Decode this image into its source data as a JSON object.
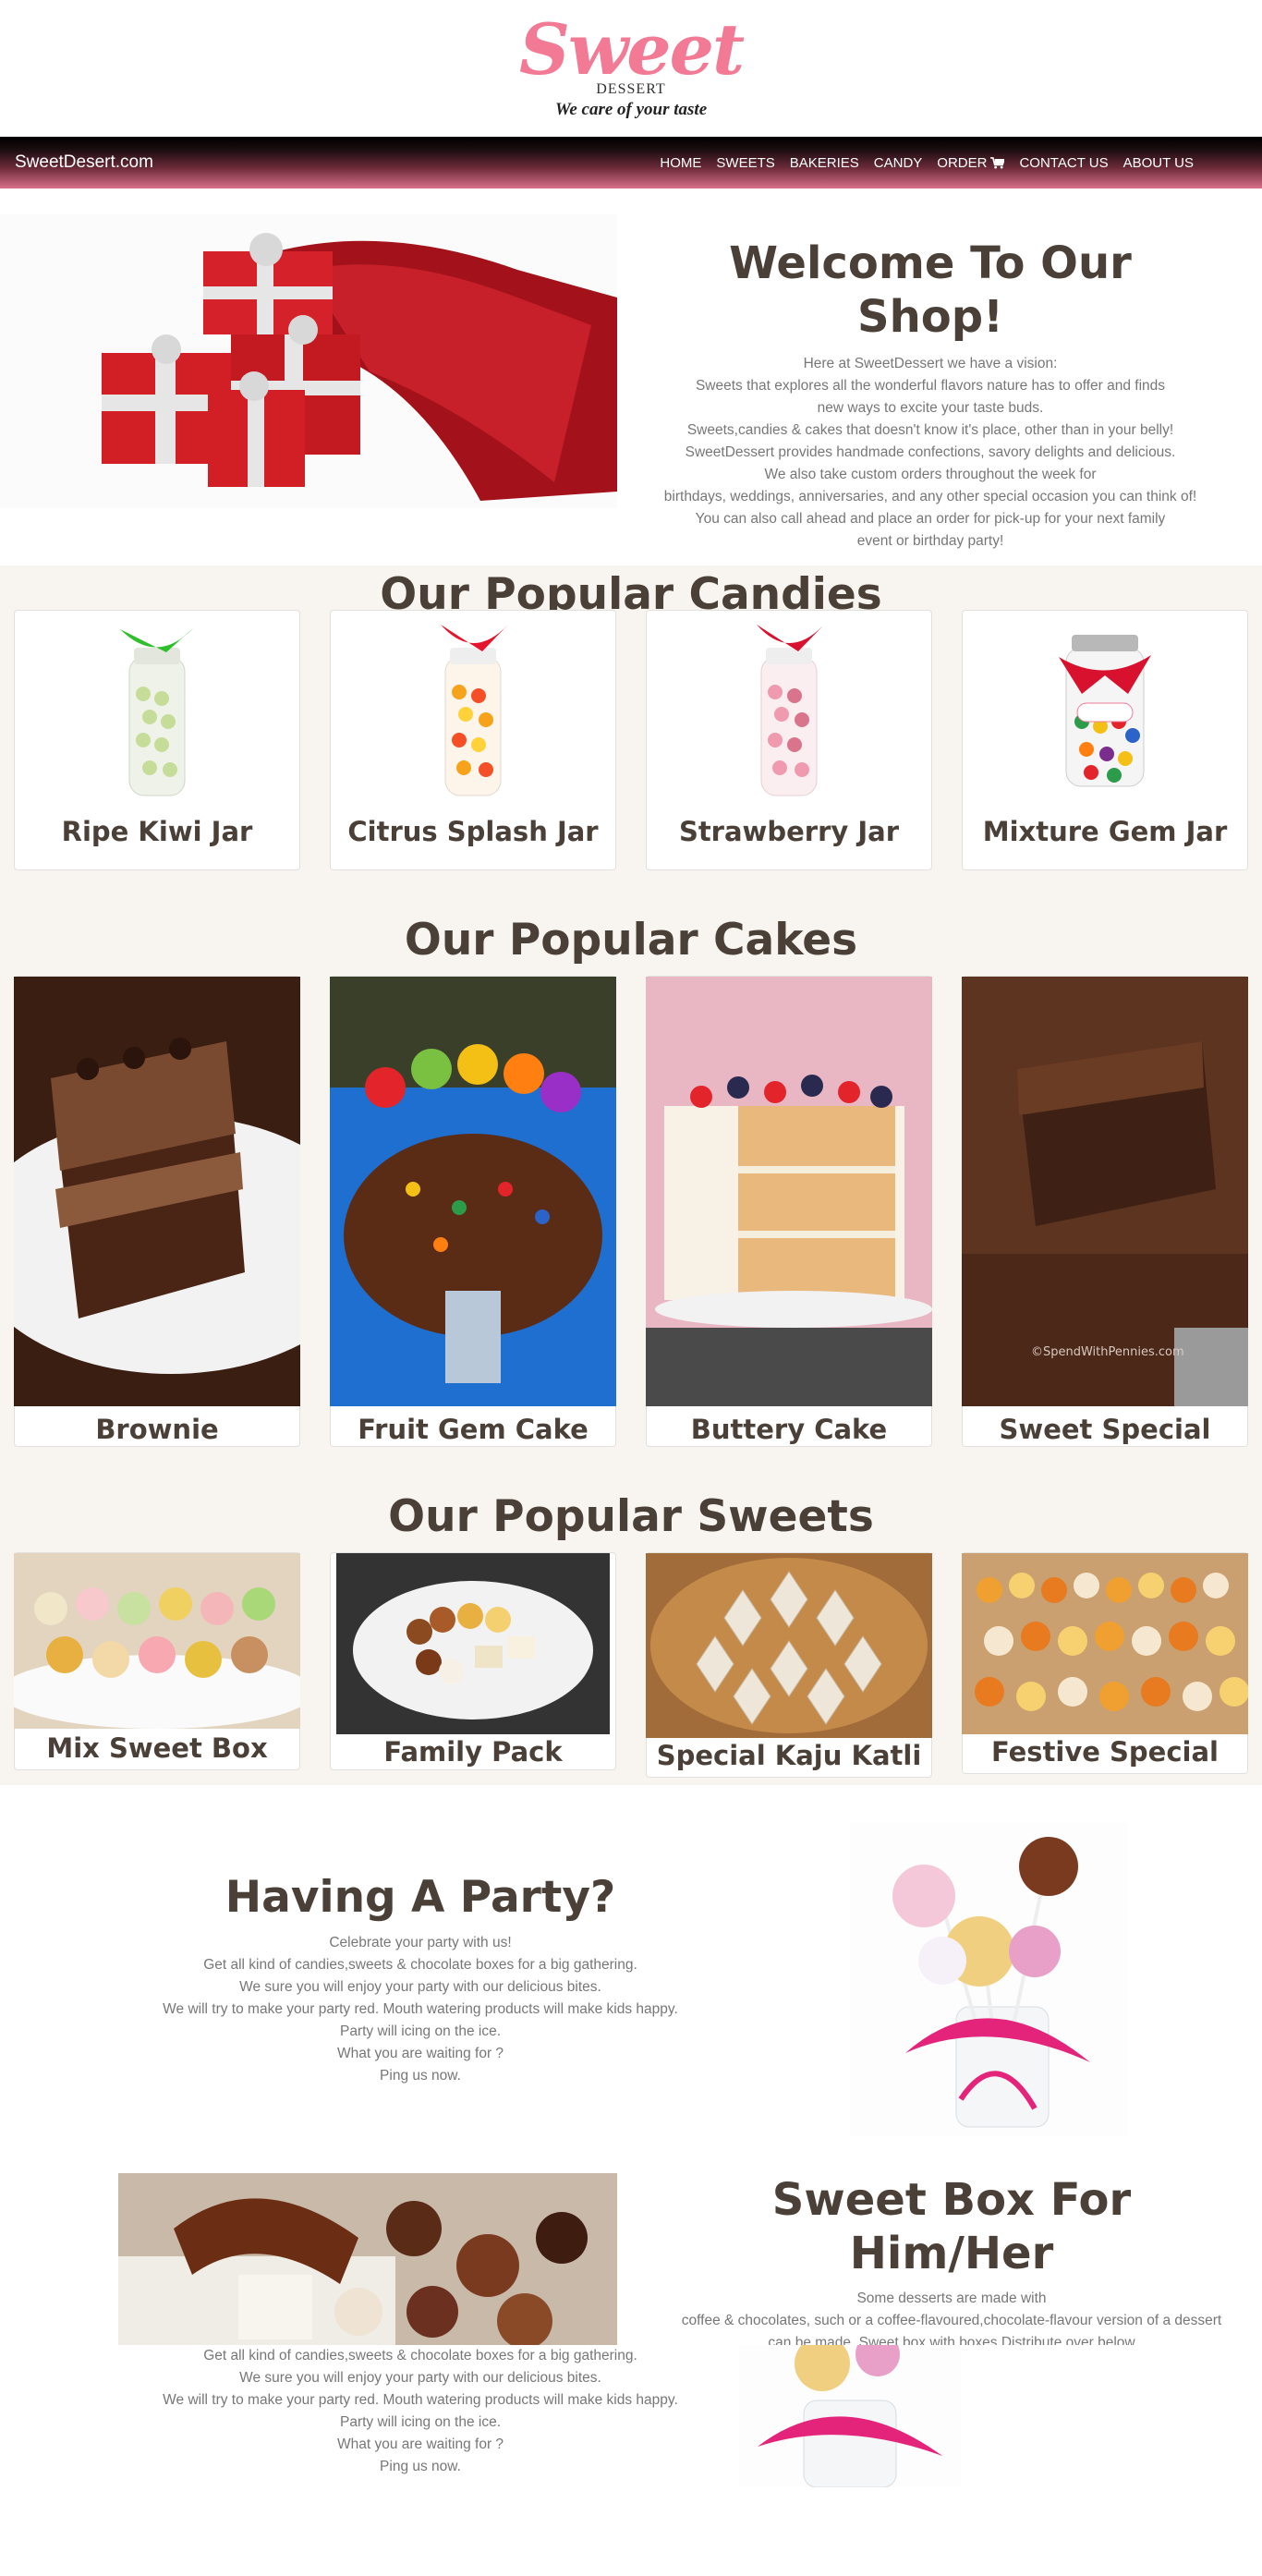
{
  "logo": {
    "main": "Sweet",
    "sub": "DESSERT",
    "tagline": "We care of your taste"
  },
  "nav": {
    "brand": "SweetDesert.com",
    "links": [
      "HOME",
      "SWEETS",
      "BAKERIES",
      "CANDY",
      "ORDER",
      "CONTACT US",
      "ABOUT US"
    ]
  },
  "welcome": {
    "title_line1": "Welcome To Our",
    "title_line2": "Shop!",
    "lines": [
      "Here at SweetDessert we have a vision:",
      "Sweets that explores all the wonderful flavors nature has to offer and finds",
      "new ways to excite your taste buds.",
      "Sweets,candies & cakes that doesn't know it's place, other than in your belly!",
      "SweetDessert provides handmade confections, savory delights and delicious.",
      "We also take custom orders throughout the week for",
      "birthdays, weddings, anniversaries, and any other special occasion you can think of!",
      "You can also call ahead and place an order for pick-up for your next family",
      "event or birthday party!"
    ]
  },
  "candies": {
    "title": "Our Popular Candies",
    "items": [
      "Ripe Kiwi Jar",
      "Citrus Splash Jar",
      "Strawberry Jar",
      "Mixture Gem Jar"
    ]
  },
  "cakes": {
    "title": "Our Popular Cakes",
    "items": [
      "Brownie",
      "Fruit Gem Cake",
      "Buttery Cake",
      "Sweet Special"
    ],
    "watermark": "©SpendWithPennies.com"
  },
  "sweets": {
    "title": "Our Popular Sweets",
    "items": [
      "Mix Sweet Box",
      "Family Pack",
      "Special Kaju Katli",
      "Festive Special"
    ]
  },
  "party": {
    "title": "Having A Party?",
    "lines": [
      "Celebrate your party with us!",
      "Get all kind of candies,sweets & chocolate boxes for a big gathering.",
      "We sure you will enjoy your party with our delicious bites.",
      "We will try to make your party red. Mouth watering products will make kids happy.",
      "Party will icing on the ice.",
      "What you are waiting for ?",
      "Ping us now."
    ]
  },
  "sweetbox": {
    "title_line1": "Sweet Box For",
    "title_line2": "Him/Her",
    "lines": [
      "Some desserts are made with",
      "coffee & chocolates, such or a coffee-flavoured,chocolate-flavour version of a dessert",
      "can be made. Sweet box with boxes Distribute over below"
    ],
    "overlap_lines": [
      "Get all kind of candies,sweets & chocolate boxes for a big gathering.",
      "We sure you will enjoy your party with our delicious bites.",
      "We will try to make your party red. Mouth watering products will make kids happy.",
      "Party will icing on the ice.",
      "What you are waiting for ?",
      "Ping us now."
    ]
  },
  "colors": {
    "brand_pink": "#f27a94",
    "heading": "#4a4038",
    "body_text": "#777777",
    "section_bg": "#f8f4f0"
  }
}
